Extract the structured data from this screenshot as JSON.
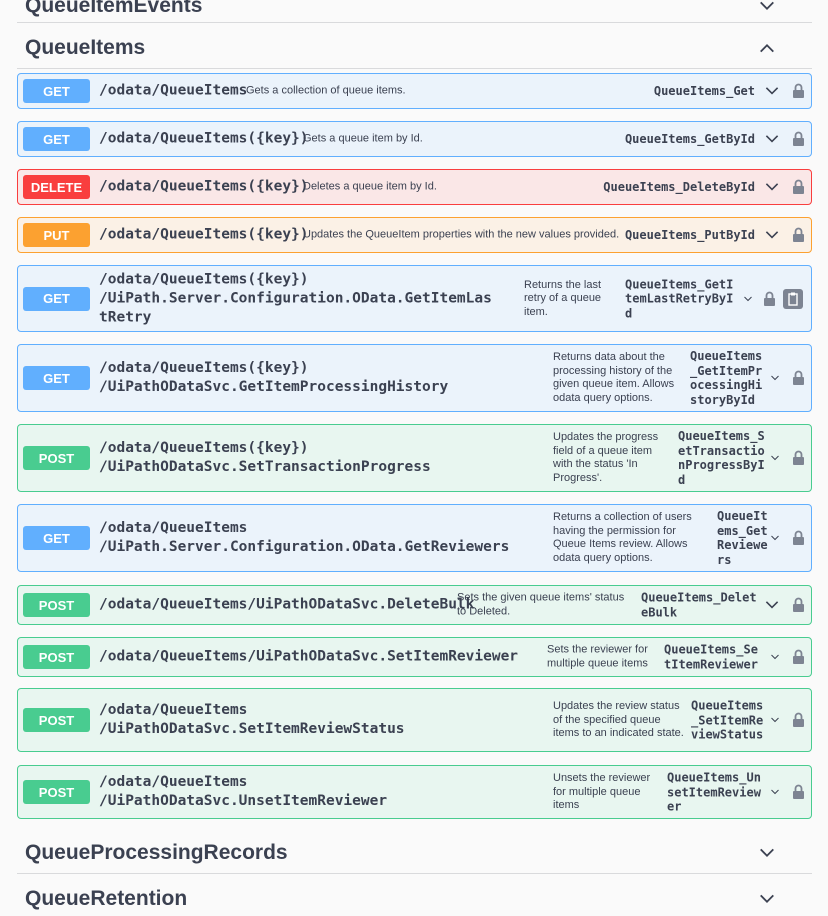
{
  "tags": {
    "events": "QueueItemEvents",
    "items": "QueueItems",
    "processing": "QueueProcessingRecords",
    "retention": "QueueRetention"
  },
  "operations": [
    {
      "method": "GET",
      "path": "/odata/QueueItems",
      "summary": "Gets a collection of queue items.",
      "opid": "QueueItems_Get"
    },
    {
      "method": "GET",
      "path": "/odata/QueueItems({key})",
      "summary": "Gets a queue item by Id.",
      "opid": "QueueItems_GetById"
    },
    {
      "method": "DELETE",
      "path": "/odata/QueueItems({key})",
      "summary": "Deletes a queue item by Id.",
      "opid": "QueueItems_DeleteById"
    },
    {
      "method": "PUT",
      "path": "/odata/QueueItems({key})",
      "summary": "Updates the QueueItem properties with the new values provided.",
      "opid": "QueueItems_PutById"
    },
    {
      "method": "GET",
      "path": "/odata/QueueItems({key})\n/UiPath.Server.Configuration.OData.GetItemLas\ntRetry",
      "summary": "Returns the last retry of a queue item.",
      "opid": "QueueItems_GetI\ntemLastRetryByI\nd"
    },
    {
      "method": "GET",
      "path": "/odata/QueueItems({key})\n/UiPathODataSvc.GetItemProcessingHistory",
      "summary": "Returns data about the processing history of the given queue item. Allows odata query options.",
      "opid": "QueueItems\n_GetItemPr\nocessingHi\nstoryById"
    },
    {
      "method": "POST",
      "path": "/odata/QueueItems({key})\n/UiPathODataSvc.SetTransactionProgress",
      "summary": "Updates the progress field of a queue item with the status 'In Progress'.",
      "opid": "QueueItems_S\netTransactio\nnProgressByI\nd"
    },
    {
      "method": "GET",
      "path": "/odata/QueueItems\n/UiPath.Server.Configuration.OData.GetReviewers",
      "summary": "Returns a collection of users having the permission for Queue Items review. Allows odata query options.",
      "opid": "QueueIt\nems_Get\nReviewe\nrs"
    },
    {
      "method": "POST",
      "path": "/odata/QueueItems/UiPathODataSvc.DeleteBulk",
      "summary": "Sets the given queue items' status to Deleted.",
      "opid": "QueueItems_Delet\neBulk"
    },
    {
      "method": "POST",
      "path": "/odata/QueueItems/UiPathODataSvc.SetItemReviewer",
      "summary": "Sets the reviewer for multiple queue items",
      "opid": "QueueItems_Se\ntItemReviewer"
    },
    {
      "method": "POST",
      "path": "/odata/QueueItems\n/UiPathODataSvc.SetItemReviewStatus",
      "summary": "Updates the review status of the specified queue items to an indicated state.",
      "opid": "QueueItems\n_SetItemRe\nviewStatus"
    },
    {
      "method": "POST",
      "path": "/odata/QueueItems\n/UiPathODataSvc.UnsetItemReviewer",
      "summary": "Unsets the reviewer for multiple queue items",
      "opid": "QueueItems_Un\nsetItemReview\ner"
    }
  ]
}
